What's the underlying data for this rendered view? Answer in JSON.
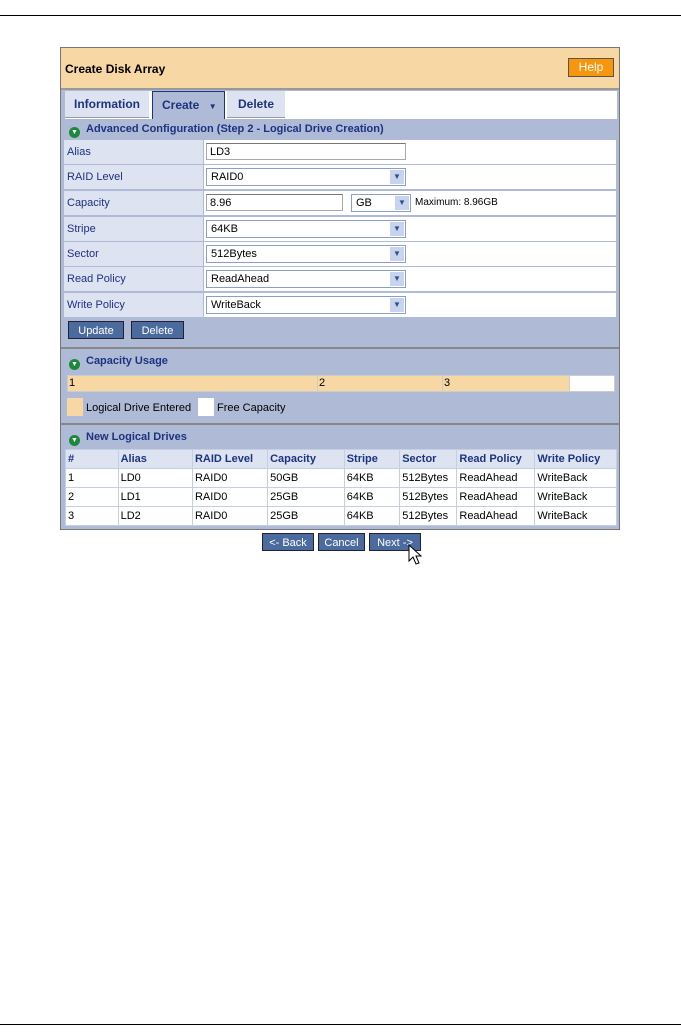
{
  "title": "Create Disk Array",
  "help": "Help",
  "tabs": [
    "Information",
    "Create",
    "Delete"
  ],
  "advanced": {
    "heading": "Advanced Configuration (Step 2 - Logical Drive Creation)",
    "alias_label": "Alias",
    "alias": "LD3",
    "raid_label": "RAID Level",
    "raid": "RAID0",
    "capacity_label": "Capacity",
    "capacity": "8.96",
    "unit": "GB",
    "maximum": "Maximum: 8.96GB",
    "stripe_label": "Stripe",
    "stripe": "64KB",
    "sector_label": "Sector",
    "sector": "512Bytes",
    "read_label": "Read Policy",
    "read": "ReadAhead",
    "write_label": "Write Policy",
    "write": "WriteBack",
    "update": "Update",
    "delete": "Delete"
  },
  "usage": {
    "heading": "Capacity Usage",
    "segments": [
      "1",
      "2",
      "3"
    ],
    "legend_entered": "Logical Drive Entered",
    "legend_free": "Free Capacity",
    "colors": {
      "entered": "#f7d7a4",
      "free": "#ffffff"
    }
  },
  "drives": {
    "heading": "New Logical Drives",
    "columns": [
      "#",
      "Alias",
      "RAID Level",
      "Capacity",
      "Stripe",
      "Sector",
      "Read Policy",
      "Write Policy"
    ],
    "rows": [
      [
        "1",
        "LD0",
        "RAID0",
        "50GB",
        "64KB",
        "512Bytes",
        "ReadAhead",
        "WriteBack"
      ],
      [
        "2",
        "LD1",
        "RAID0",
        "25GB",
        "64KB",
        "512Bytes",
        "ReadAhead",
        "WriteBack"
      ],
      [
        "3",
        "LD2",
        "RAID0",
        "25GB",
        "64KB",
        "512Bytes",
        "ReadAhead",
        "WriteBack"
      ]
    ]
  },
  "nav": {
    "back": "<- Back",
    "cancel": "Cancel",
    "next": "Next ->"
  }
}
